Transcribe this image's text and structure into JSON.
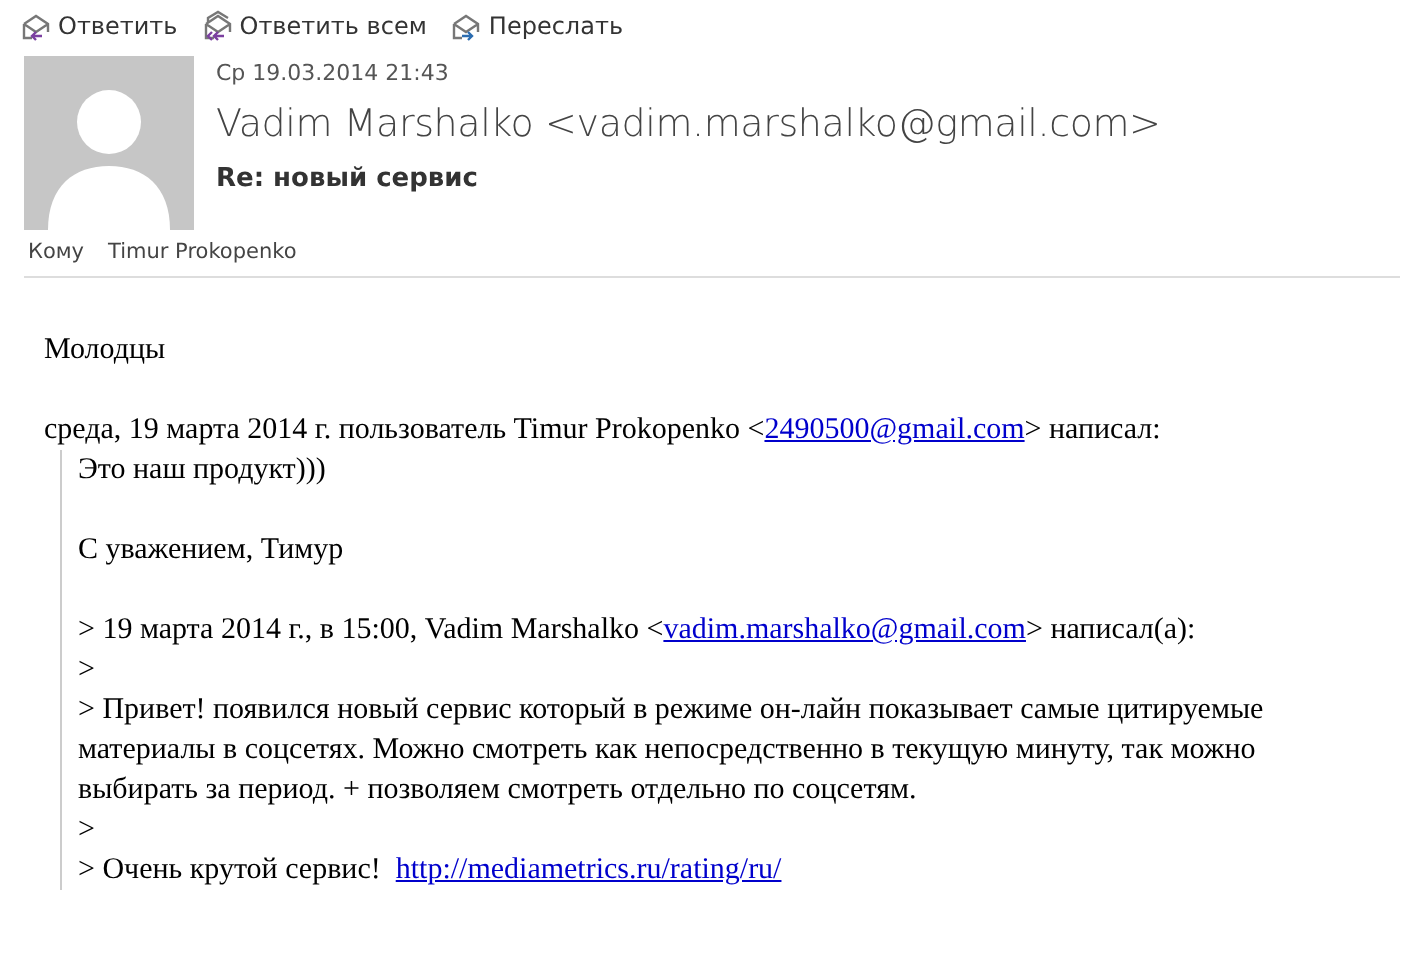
{
  "toolbar": [
    {
      "kind": "reply",
      "label": "Ответить"
    },
    {
      "kind": "reply_all",
      "label": "Ответить всем"
    },
    {
      "kind": "forward",
      "label": "Переслать"
    }
  ],
  "header": {
    "date": "Ср 19.03.2014 21:43",
    "sender": "Vadim Marshalko <vadim.marshalko@gmail.com>",
    "subject": "Re: новый сервис",
    "to_label": "Кому",
    "to_name": "Timur Prokopenko"
  },
  "body": [
    {
      "lines": [
        {
          "text": "Молодцы"
        }
      ]
    },
    {
      "lines": [
        {
          "text": "среда, 19 марта 2014 г. пользователь Timur Prokopenko <",
          "link": "2490500@gmail.com",
          "after": "> написал:"
        }
      ]
    }
  ],
  "quote": [
    {
      "lines": [
        {
          "text": "Это наш продукт)))"
        }
      ]
    },
    {
      "lines": [
        {
          "text": "С уважением, Тимур"
        }
      ]
    },
    {
      "lines": [
        {
          "text": "> 19 марта 2014 г., в 15:00, Vadim Marshalko <",
          "link": "vadim.marshalko@gmail.com",
          "after": "> написал(а):"
        },
        {
          "text": ">"
        },
        {
          "text": "> Привет! появился новый сервис который в режиме он-лайн показывает самые цитируемые материалы в соцсетях. Можно смотреть как непосредственно в текущую минуту, так можно выбирать за период. + позволяем смотреть отдельно по соцсетям."
        },
        {
          "text": ">"
        },
        {
          "text": "> Очень крутой сервис!  ",
          "link": "http://mediametrics.ru/rating/ru/"
        }
      ]
    }
  ]
}
